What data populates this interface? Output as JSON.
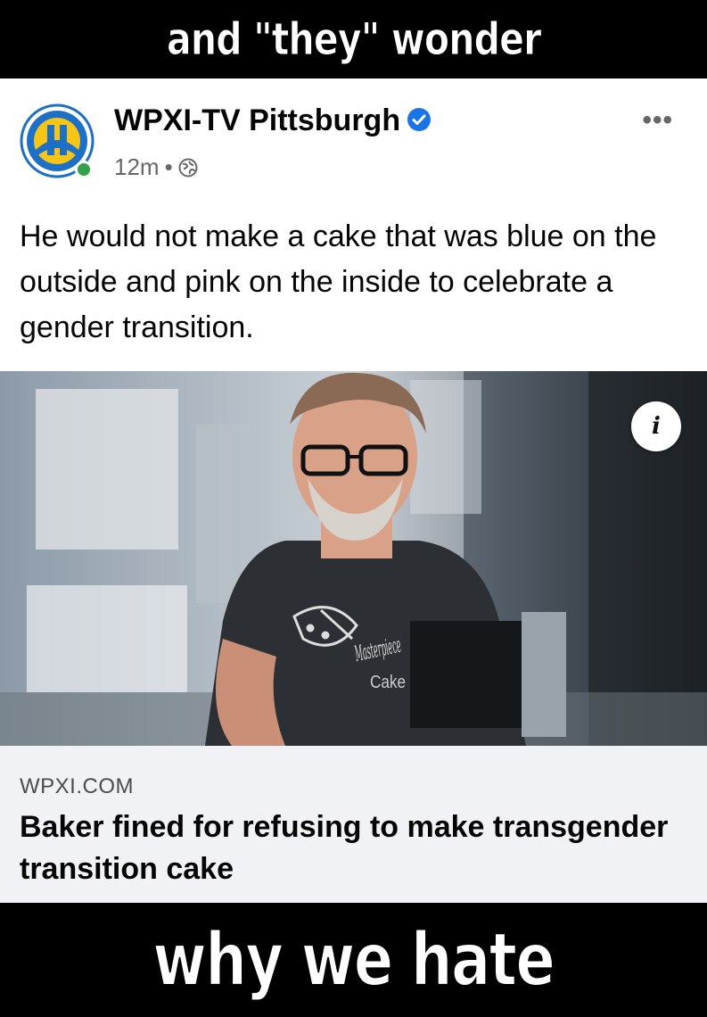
{
  "meme": {
    "top_caption": "and \"they\" wonder",
    "bottom_caption": "why we hate"
  },
  "post": {
    "page_name": "WPXI-TV Pittsburgh",
    "time": "12m",
    "separator": "•",
    "more_label": "•••",
    "text": "He would not make a cake that was blue on the outside and pink on the inside to celebrate a gender transition.",
    "photo_info_label": "i",
    "shirt_text_line1": "Masterpiece",
    "shirt_text_line2": "Cake",
    "link": {
      "domain": "WPXI.COM",
      "headline": "Baker fined for refusing to make transgender transition cake"
    }
  },
  "colors": {
    "verified": "#1b74e4",
    "online": "#31a24c",
    "logo_blue": "#1e6fc6",
    "logo_yellow": "#f5c518"
  }
}
